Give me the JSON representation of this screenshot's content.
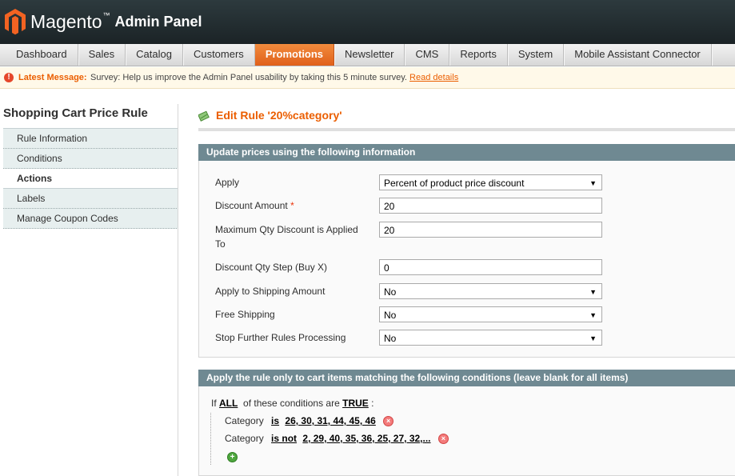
{
  "header": {
    "brand": "Magento",
    "trademark": "™",
    "subtitle": "Admin Panel"
  },
  "nav": {
    "items": [
      "Dashboard",
      "Sales",
      "Catalog",
      "Customers",
      "Promotions",
      "Newsletter",
      "CMS",
      "Reports",
      "System",
      "Mobile Assistant Connector"
    ],
    "active": "Promotions"
  },
  "notice": {
    "label": "Latest Message:",
    "text": "Survey: Help us improve the Admin Panel usability by taking this 5 minute survey.",
    "link": "Read details",
    "icon": "!"
  },
  "sidebar": {
    "title": "Shopping Cart Price Rule",
    "tabs": [
      "Rule Information",
      "Conditions",
      "Actions",
      "Labels",
      "Manage Coupon Codes"
    ],
    "active_tab": "Actions"
  },
  "page": {
    "title": "Edit Rule '20%category'"
  },
  "actions": {
    "heading": "Update prices using the following information",
    "apply_label": "Apply",
    "apply_value": "Percent of product price discount",
    "discount_amount_label": "Discount Amount",
    "required_mark": "*",
    "discount_amount_value": "20",
    "max_qty_label": "Maximum Qty Discount is Applied To",
    "max_qty_value": "20",
    "qty_step_label": "Discount Qty Step (Buy X)",
    "qty_step_value": "0",
    "shipping_label": "Apply to Shipping Amount",
    "shipping_value": "No",
    "free_shipping_label": "Free Shipping",
    "free_shipping_value": "No",
    "stop_rules_label": "Stop Further Rules Processing",
    "stop_rules_value": "No",
    "dropdown_arrow": "▼"
  },
  "conditions": {
    "heading": "Apply the rule only to cart items matching the following conditions (leave blank for all items)",
    "if_text": "If",
    "aggregator": "ALL",
    "middle_text": "of these conditions are",
    "value": "TRUE",
    "colon": ":",
    "rows": [
      {
        "attribute": "Category",
        "operator": "is",
        "values": "26, 30, 31, 44, 45, 46"
      },
      {
        "attribute": "Category",
        "operator": "is not",
        "values": "2, 29, 40, 35, 36, 25, 27, 32,..."
      }
    ],
    "remove_glyph": "×",
    "add_glyph": "+"
  },
  "colors": {
    "accent": "#eb5e00",
    "active_tab": "#e0601a",
    "section_header": "#6f8992",
    "header_bg": "#1b2326"
  }
}
